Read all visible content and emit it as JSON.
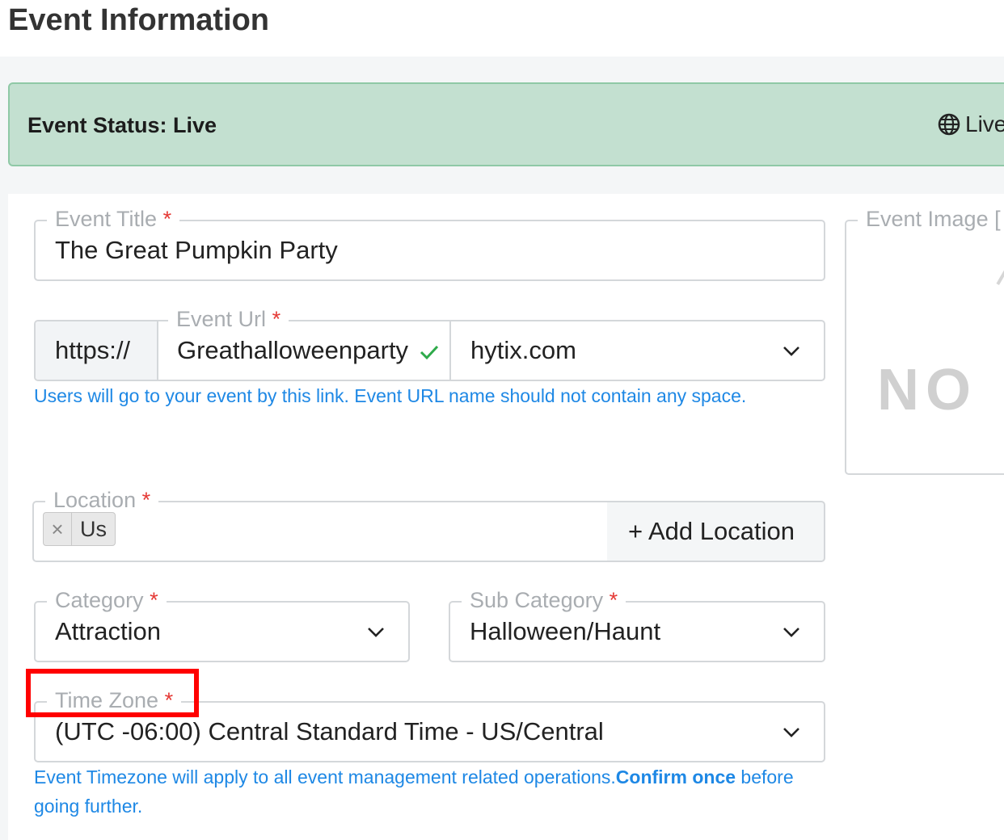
{
  "page": {
    "title": "Event Information"
  },
  "status": {
    "label": "Event Status: Live",
    "live_button": "Live"
  },
  "form": {
    "event_title": {
      "label": "Event Title",
      "required": "*",
      "value": "The Great Pumpkin Party"
    },
    "event_url": {
      "label": "Event Url",
      "required": "*",
      "prefix": "https://",
      "value": "Greathalloweenparty",
      "domain": "hytix.com",
      "help": "Users will go to your event by this link. Event URL name should not contain any space."
    },
    "location": {
      "label": "Location",
      "required": "*",
      "tag": "Us",
      "tag_remove": "×",
      "add_button": "+ Add Location"
    },
    "category": {
      "label": "Category",
      "required": "*",
      "value": "Attraction"
    },
    "sub_category": {
      "label": "Sub Category",
      "required": "*",
      "value": "Halloween/Haunt"
    },
    "time_zone": {
      "label": "Time Zone",
      "required": "*",
      "value": "(UTC -06:00) Central Standard Time - US/Central",
      "help_part1": "Event Timezone will apply to all event management related operations.",
      "help_bold": "Confirm once",
      "help_part2": " before",
      "help_line2": "going further."
    },
    "event_image": {
      "label": "Event Image [",
      "placeholder": "NO"
    }
  },
  "colors": {
    "accent": "#1e88e5",
    "required": "#e53935",
    "highlight": "#ff0000",
    "status_bg": "#c3e0d0",
    "check": "#2eaa4a"
  },
  "icons": [
    "globe-icon",
    "check-icon",
    "chevron-down-icon",
    "close-icon"
  ]
}
